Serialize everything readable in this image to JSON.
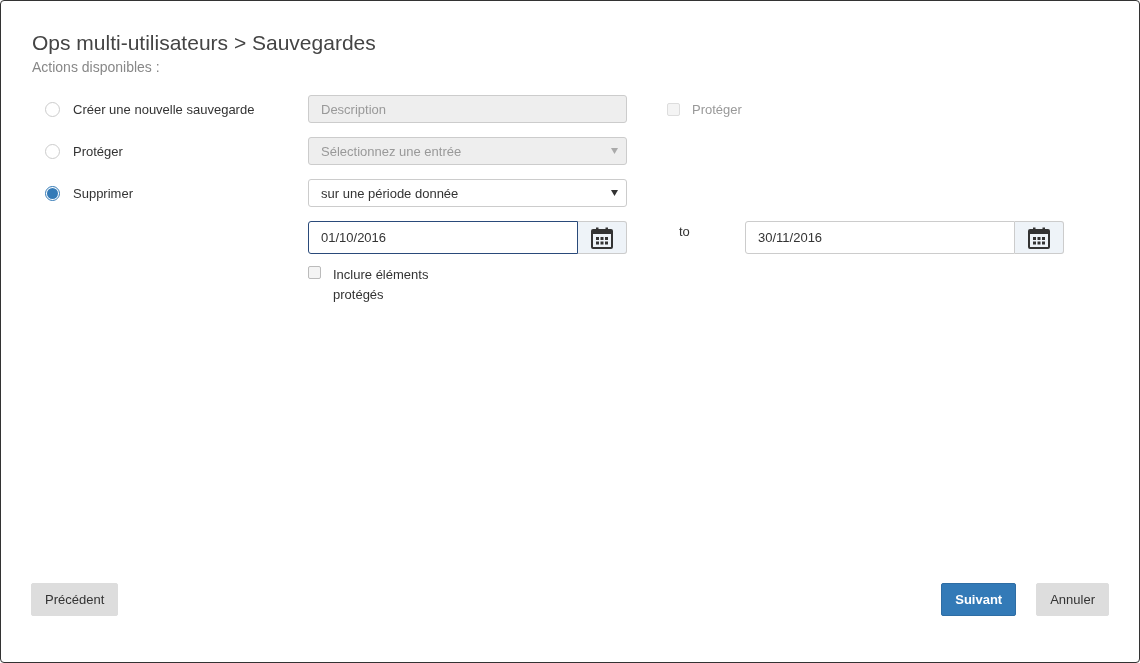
{
  "title": "Ops multi-utilisateurs > Sauvegardes",
  "subtitle": "Actions disponibles :",
  "actions": [
    {
      "label": "Créer une nouvelle sauvegarde",
      "selected": false
    },
    {
      "label": "Protéger",
      "selected": false
    },
    {
      "label": "Supprimer",
      "selected": true
    }
  ],
  "description_field": {
    "placeholder": "Description",
    "disabled": true
  },
  "protect_checkbox": {
    "label": "Protéger",
    "checked": false,
    "disabled": true
  },
  "entry_select": {
    "placeholder": "Sélectionnez une entrée",
    "disabled": true
  },
  "period_select": {
    "value": "sur une période donnée",
    "disabled": false
  },
  "date_from": {
    "value": "01/10/2016",
    "focused": true
  },
  "to_label": "to",
  "date_to": {
    "value": "30/11/2016",
    "focused": false
  },
  "include_protected": {
    "label": "Inclure éléments protégés",
    "checked": false
  },
  "buttons": [
    {
      "label": "Précédent",
      "kind": "default"
    },
    {
      "label": "Suivant",
      "kind": "primary"
    },
    {
      "label": "Annuler",
      "kind": "default"
    }
  ]
}
